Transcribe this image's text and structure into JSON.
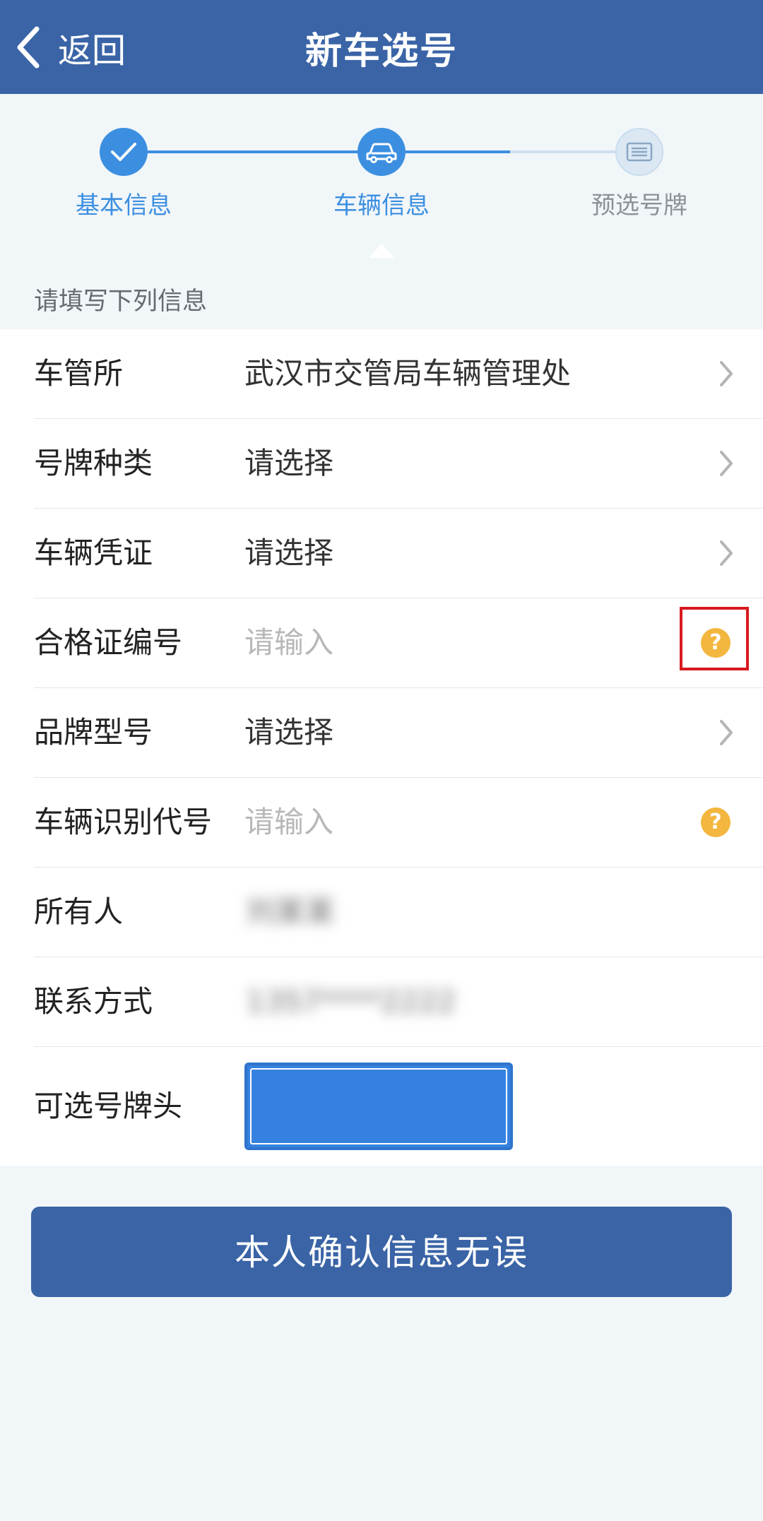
{
  "header": {
    "back_label": "返回",
    "title": "新车选号"
  },
  "steps": [
    {
      "label": "基本信息",
      "state": "done",
      "icon": "check-icon"
    },
    {
      "label": "车辆信息",
      "state": "current",
      "icon": "car-icon"
    },
    {
      "label": "预选号牌",
      "state": "pending",
      "icon": "plate-icon"
    }
  ],
  "hint": "请填写下列信息",
  "form": {
    "rows": [
      {
        "label": "车管所",
        "value": "武汉市交管局车辆管理处",
        "type": "select"
      },
      {
        "label": "号牌种类",
        "value": "请选择",
        "type": "select"
      },
      {
        "label": "车辆凭证",
        "value": "请选择",
        "type": "select"
      },
      {
        "label": "合格证编号",
        "placeholder": "请输入",
        "type": "input-help"
      },
      {
        "label": "品牌型号",
        "value": "请选择",
        "type": "select"
      },
      {
        "label": "车辆识别代号",
        "placeholder": "请输入",
        "type": "input-help"
      },
      {
        "label": "所有人",
        "value": "刘某某",
        "type": "blurred"
      },
      {
        "label": "联系方式",
        "value": "1357****2222",
        "type": "blurred"
      },
      {
        "label": "可选号牌头",
        "type": "plate"
      }
    ]
  },
  "help_mark": "?",
  "confirm_label": "本人确认信息无误",
  "colors": {
    "primary": "#3a64a6",
    "step_active": "#3c8fe0",
    "step_pending": "#dbe8f4",
    "help": "#f3b63e",
    "highlight": "#d8191f",
    "plate": "#3581e0"
  }
}
